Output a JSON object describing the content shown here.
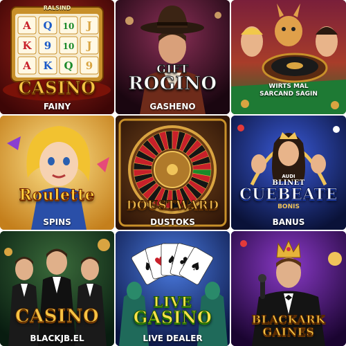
{
  "tiles": [
    {
      "name": "fainy-casino",
      "badge": "RALSIND",
      "logo": "CASINO",
      "caption": "FAINY",
      "slot_symbols": [
        "A",
        "Q",
        "10",
        "J",
        "K",
        "9",
        "10",
        "J",
        "A",
        "K",
        "Q",
        "9"
      ]
    },
    {
      "name": "gift-rogino",
      "logo_line1": "GIFT",
      "logo_line2": "ROGINO",
      "caption": "GASHENO"
    },
    {
      "name": "wirts-mal",
      "subtext_line1": "WIRTS MAL",
      "subtext_line2": "SARCAND SAGIN"
    },
    {
      "name": "roulette-spins",
      "logo": "Roulette",
      "caption": "SPINS"
    },
    {
      "name": "doustoks",
      "logo": "DOUSTWARD",
      "caption": "DUSTOKS"
    },
    {
      "name": "cuebeate-banus",
      "logo_top": "AUDI",
      "logo_line1": "BLINET",
      "logo_line2": "CUEBEATE",
      "logo_sub": "BONIS",
      "caption": "BANUS"
    },
    {
      "name": "casino-blackjack",
      "logo": "CASINO",
      "caption": "BLACKJB.EL"
    },
    {
      "name": "live-casino",
      "logo_line1": "LIVE",
      "logo_line2": "GASINO",
      "caption": "LIVE DEALER"
    },
    {
      "name": "blackark-gaines",
      "logo_line1": "BLACKARK",
      "logo_line2": "GAINES"
    }
  ],
  "colors": {
    "gold": "#f6c343",
    "dark_red": "#5a0b0b",
    "navy": "#0d1b4a",
    "purple": "#3b0d5c",
    "green": "#0e3b22"
  }
}
